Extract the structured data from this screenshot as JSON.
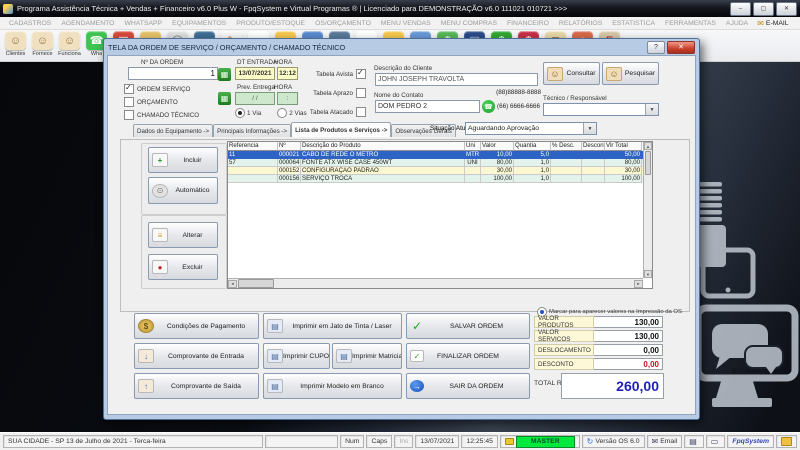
{
  "window": {
    "title": "Programa Assistência Técnica + Vendas + Financeiro v6.0 Plus W - FpqSystem e Virtual Programas ® | Licenciado para  DEMONSTRAÇÃO v6.0 111021 010721 >>>",
    "controls": {
      "minimize": "–",
      "maximize": "▢",
      "close": "✕"
    }
  },
  "menu": {
    "items": [
      {
        "label": "CADASTROS"
      },
      {
        "label": "AGENDAMENTO"
      },
      {
        "label": "WHATSAPP"
      },
      {
        "label": "EQUIPAMENTOS"
      },
      {
        "label": "PRODUTO/ESTOQUE"
      },
      {
        "label": "OS/ORÇAMENTO"
      },
      {
        "label": "MENU VENDAS"
      },
      {
        "label": "MENU COMPRAS"
      },
      {
        "label": "FINANCEIRO"
      },
      {
        "label": "RELATÓRIOS"
      },
      {
        "label": "ESTATISTICA"
      },
      {
        "label": "FERRAMENTAS"
      },
      {
        "label": "AJUDA"
      }
    ],
    "email_label": "E-MAIL"
  },
  "toolbar": {
    "items": [
      {
        "name": "toolbar-clientes",
        "label": "Clientes",
        "glyph": "☺",
        "bg": "#f0e0c0",
        "fg": "#8a6a3a"
      },
      {
        "name": "toolbar-fornecedor",
        "label": "Fornece",
        "glyph": "☺",
        "bg": "#f0e0c0",
        "fg": "#8a6a3a"
      },
      {
        "name": "toolbar-funcionario",
        "label": "Funciona",
        "glyph": "☺",
        "bg": "#f0e0c0",
        "fg": "#8a6a3a"
      },
      {
        "name": "toolbar-whatsapp",
        "label": "Wha",
        "glyph": "☎",
        "bg": "#3fc351",
        "fg": "#ffffff"
      },
      {
        "name": "toolbar-agenda",
        "label": "",
        "glyph": "▦",
        "bg": "#d84a3a",
        "fg": "#ffffff"
      },
      {
        "name": "toolbar-estoque",
        "label": "",
        "glyph": "■",
        "bg": "#e8c26a",
        "fg": "#7a5a20"
      },
      {
        "name": "toolbar-servico",
        "label": "",
        "glyph": "◯",
        "bg": "#e0e0e0",
        "fg": "#777777"
      },
      {
        "name": "toolbar-twitter",
        "label": "",
        "glyph": "●",
        "bg": "#3e6f95",
        "fg": "#12303f"
      },
      {
        "name": "toolbar-editar",
        "label": "",
        "glyph": "✎",
        "bg": "#f8f8f8",
        "fg": "#d87a2a"
      },
      {
        "name": "toolbar-consulta",
        "label": "",
        "glyph": "≡",
        "bg": "#ffffff",
        "fg": "#4a6a9a"
      },
      {
        "name": "toolbar-pasta-os",
        "label": "",
        "glyph": "",
        "bg": "#f6c94e",
        "fg": "#a87a1a"
      },
      {
        "name": "toolbar-orcamento",
        "label": "",
        "glyph": "◔",
        "bg": "#5a8ad0",
        "fg": "#eaf2ff"
      },
      {
        "name": "toolbar-monitor",
        "label": "",
        "glyph": "▭",
        "bg": "#5a7a9a",
        "fg": "#d8e6f2"
      },
      {
        "name": "toolbar-relatorio",
        "label": "",
        "glyph": "≡",
        "bg": "#ffffff",
        "fg": "#888888"
      },
      {
        "name": "toolbar-pasta-vendas",
        "label": "",
        "glyph": "",
        "bg": "#f6c94e",
        "fg": "#a87a1a"
      },
      {
        "name": "toolbar-compras",
        "label": "",
        "glyph": "◔",
        "bg": "#6a9ad8",
        "fg": "#eaf2ff"
      },
      {
        "name": "toolbar-financeiro",
        "label": "",
        "glyph": "$",
        "bg": "#58b858",
        "fg": "#ffffff"
      },
      {
        "name": "toolbar-cheque",
        "label": "",
        "glyph": "▤",
        "bg": "#2a4a8a",
        "fg": "#cdddf0"
      },
      {
        "name": "toolbar-receber",
        "label": "",
        "glyph": "$",
        "bg": "#30a830",
        "fg": "#ffffff"
      },
      {
        "name": "toolbar-pagar",
        "label": "",
        "glyph": "$",
        "bg": "#c83048",
        "fg": "#ffffff"
      },
      {
        "name": "toolbar-recibo",
        "label": "",
        "glyph": "≣",
        "bg": "#e8d8a8",
        "fg": "#907840"
      },
      {
        "name": "toolbar-pessoa",
        "label": "",
        "glyph": "☺",
        "bg": "#d86a4a",
        "fg": "#ffffff"
      },
      {
        "name": "toolbar-exit",
        "label": "",
        "glyph": "E",
        "bg": "#d8c8a8",
        "fg": "#b02020"
      }
    ]
  },
  "icons": {
    "help": "?",
    "dialog_close": "✕",
    "email": "✉",
    "arrow_down": "▼",
    "calendar": "▦",
    "whatsapp": "☎",
    "people": "☺",
    "plus": "+",
    "auto": "⊙",
    "lines": "≡",
    "dot": "●",
    "coin": "$",
    "down": "↓",
    "up": "↑",
    "printer": "▤",
    "check": "✓",
    "exit_arrow": "→",
    "scroll_up": "▲",
    "scroll_down": "▼",
    "scroll_left": "◄",
    "scroll_right": "►",
    "refresh": "↻",
    "monitor": "▭"
  },
  "dialog": {
    "title": "TELA DA ORDEM DE SERVIÇO / ORÇAMENTO / CHAMADO TÉCNICO",
    "order": {
      "label": "Nº DA ORDEM",
      "value": "1"
    },
    "type_checks": [
      {
        "label": "ORDEM SERVIÇO",
        "checked": true
      },
      {
        "label": "ORÇAMENTO",
        "checked": false
      },
      {
        "label": "CHAMADO TÉCNICO",
        "checked": false
      }
    ],
    "entry": {
      "date_label": "DT ENTRADA",
      "hora_label": "HORA",
      "date": "13/07/2021",
      "time": "12:12"
    },
    "prev": {
      "label": "Prev. Entrega",
      "hora_label": "HORA",
      "date": "/ /",
      "time": ":"
    },
    "vias": [
      {
        "label": "1 Via",
        "selected": true
      },
      {
        "label": "2 Vias",
        "selected": false
      }
    ],
    "tabelas": [
      {
        "label": "Tabela Avista",
        "checked": true
      },
      {
        "label": "Tabela Aprazo",
        "checked": false
      },
      {
        "label": "Tabela Atacado",
        "checked": false
      }
    ],
    "cliente": {
      "label": "Descrição do Cliente",
      "value": "JOHN JOSEPH TRAVOLTA"
    },
    "contato": {
      "label": "Nome do Contato",
      "value": "DOM PEDRO 2"
    },
    "phones": {
      "phone1": "(88)88888-8888",
      "phone2": "(66) 6666-6666"
    },
    "consultar_label": "Consultar",
    "pesquisar_label": "Pesquisar",
    "tecnico": {
      "label": "Técnico / Responsável",
      "value": ""
    },
    "tabs": [
      {
        "label": "Dados do Equipamento ->",
        "active": false
      },
      {
        "label": "Principais Informações ->",
        "active": false
      },
      {
        "label": "Lista de Produtos e Serviços ->",
        "active": true
      },
      {
        "label": "Observações Gerais",
        "active": false
      }
    ],
    "situacao": {
      "label": "Situação Atual",
      "value": "Aguardando Aprovação"
    },
    "side": {
      "incluir": "Incluir",
      "automatico": "Automático",
      "alterar": "Alterar",
      "excluir": "Excluir"
    },
    "table": {
      "headers": [
        "Referencia",
        "Nº",
        "Descrição do Produto",
        "Uni",
        "Valor",
        "Quantia",
        "% Desc.",
        "Desconto",
        "Vlr Total"
      ],
      "rows": [
        {
          "tone": "sel",
          "cells": [
            "11",
            "000021",
            "CABO DE REDE O METRO",
            "MTR",
            "10,00",
            "5,0",
            "",
            "",
            "50,00"
          ]
        },
        {
          "tone": "green",
          "cells": [
            "57",
            "000064",
            "FONTE ATX WISE CASE 450WT",
            "UNI",
            "80,00",
            "1,0",
            "",
            "",
            "80,00"
          ]
        },
        {
          "tone": "yellow",
          "cells": [
            "",
            "000152",
            "CONFIGURAÇÃO PADRAO",
            "",
            "30,00",
            "1,0",
            "",
            "",
            "30,00"
          ]
        },
        {
          "tone": "green",
          "cells": [
            "",
            "000156",
            "SERVIÇO TROCA",
            "",
            "100,00",
            "1,0",
            "",
            "",
            "100,00"
          ]
        }
      ]
    },
    "actions": {
      "pagamento": "Condições de Pagamento",
      "entrada": "Comprovante de Entrada",
      "saida": "Comprovante de Saída",
      "jato": "Imprimir em Jato de Tinta / Laser",
      "cupom": "Imprimir CUPOM",
      "matricial": "Imprimir Matricial",
      "branco": "Imprimir Modelo em Branco",
      "salvar": "SALVAR ORDEM",
      "finalizar": "FINALIZAR ORDEM",
      "sair": "SAIR DA ORDEM"
    },
    "totals": {
      "print_note": "Marcar para aparecer valores na Impressão da OS",
      "rows": [
        {
          "label": "VALOR PRODUTOS",
          "value": "130,00",
          "red": false
        },
        {
          "label": "VALOR SERVICOS",
          "value": "130,00",
          "red": false
        },
        {
          "label": "DESLOCAMENTO",
          "value": "0,00",
          "red": false
        },
        {
          "label": "DESCONTO",
          "value": "0,00",
          "red": true
        }
      ],
      "total_label": "TOTAL R$",
      "total_value": "260,00"
    }
  },
  "status": {
    "city": "SUA CIDADE - SP 13 de Julho de 2021 - Terca-feira",
    "num": "Num",
    "caps": "Caps",
    "ins": "Ins",
    "date": "13/07/2021",
    "time": "12:25:45",
    "master": "MASTER",
    "versao": "Versão OS 6.0",
    "email": "Email",
    "brand": "FpqSystem"
  }
}
